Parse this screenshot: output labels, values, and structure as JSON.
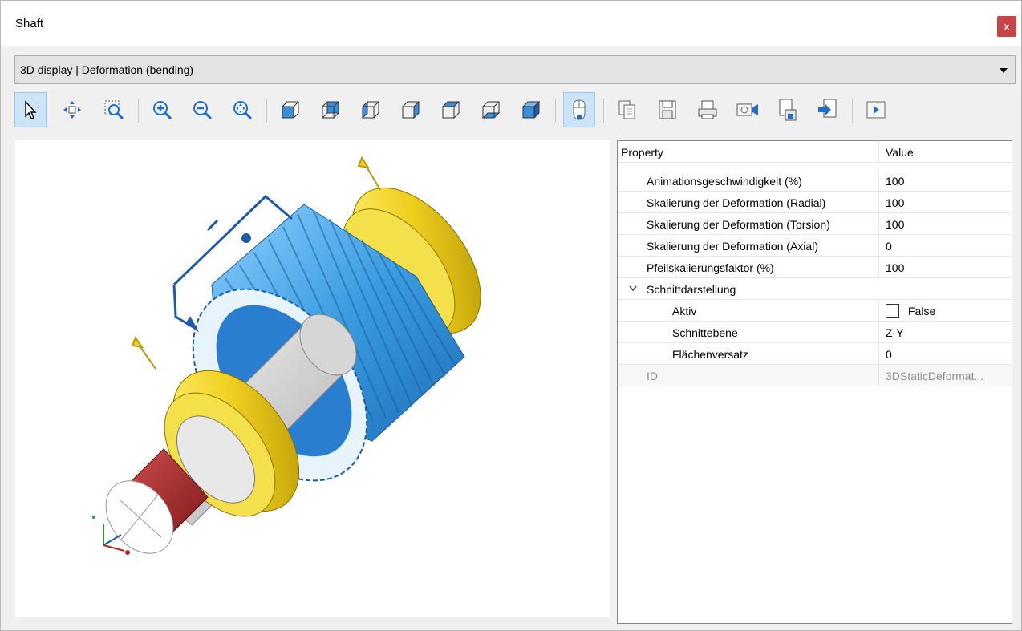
{
  "window": {
    "title": "Shaft",
    "close_label": "x"
  },
  "display_select": {
    "value": "3D display | Deformation (bending)"
  },
  "colors": {
    "gear": "#3a9ce0",
    "bearing": "#f0d020",
    "shaft_red": "#b02828",
    "accent_blue": "#1e5aa6",
    "close": "#c84545"
  },
  "toolbar": {
    "buttons": [
      "select-cursor-icon",
      "pan-icon",
      "zoom-window-icon",
      "zoom-in-icon",
      "zoom-out-icon",
      "zoom-extents-icon",
      "view-cube-front-icon",
      "view-cube-back-icon",
      "view-cube-left-icon",
      "view-cube-right-icon",
      "view-cube-top-icon",
      "view-cube-bottom-icon",
      "view-cube-iso-icon",
      "mouse-mode-icon",
      "copy-icon",
      "save-icon",
      "print-icon",
      "video-record-icon",
      "export-icon",
      "import-icon",
      "play-icon"
    ]
  },
  "propgrid": {
    "header": {
      "name": "Property",
      "value": "Value"
    },
    "rows": [
      {
        "name": "Animationsgeschwindigkeit (%)",
        "value": "100"
      },
      {
        "name": "Skalierung der Deformation (Radial)",
        "value": "100"
      },
      {
        "name": "Skalierung der Deformation (Torsion)",
        "value": "100"
      },
      {
        "name": "Skalierung der Deformation (Axial)",
        "value": "0"
      },
      {
        "name": "Pfeilskalierungsfaktor (%)",
        "value": "100"
      }
    ],
    "group": {
      "name": "Schnittdarstellung"
    },
    "sub_rows": [
      {
        "name": "Aktiv",
        "value": "False"
      },
      {
        "name": "Schnittebene",
        "value": "Z-Y"
      },
      {
        "name": "Flächenversatz",
        "value": "0"
      }
    ],
    "id_row": {
      "name": "ID",
      "value": "3DStaticDeformat..."
    }
  }
}
